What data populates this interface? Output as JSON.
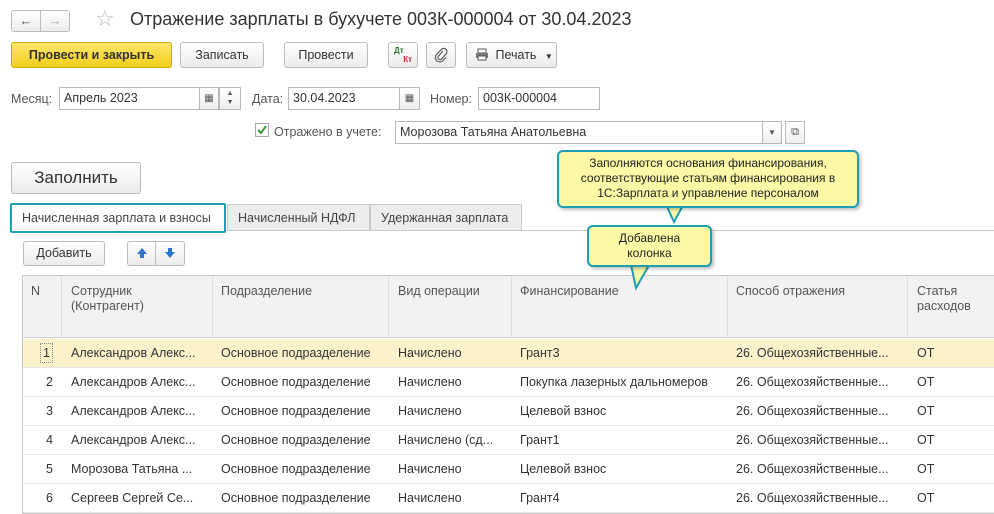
{
  "window": {
    "title": "Отражение зарплаты в бухучете 003К-000004 от 30.04.2023"
  },
  "toolbar": {
    "post_close": "Провести и закрыть",
    "save": "Записать",
    "post": "Провести",
    "dtkt_top": "Дт",
    "dtkt_bottom": "Кт",
    "print": "Печать"
  },
  "form": {
    "month_label": "Месяц:",
    "month_value": "Апрель 2023",
    "date_label": "Дата:",
    "date_value": "30.04.2023",
    "number_label": "Номер:",
    "number_value": "003К-000004",
    "reflected_label": "Отражено в учете:",
    "reflected_checked": true,
    "responsible_value": "Морозова Татьяна Анатольевна"
  },
  "fill_button": "Заполнить",
  "tabs": [
    {
      "label": "Начисленная зарплата и взносы",
      "active": true
    },
    {
      "label": "Начисленный НДФЛ",
      "active": false
    },
    {
      "label": "Удержанная зарплата",
      "active": false
    }
  ],
  "table_toolbar": {
    "add": "Добавить"
  },
  "table": {
    "columns": [
      "N",
      "Сотрудник (Контрагент)",
      "Подразделение",
      "Вид операции",
      "Финансирование",
      "Способ отражения",
      "Статья расходов"
    ],
    "rows": [
      {
        "n": "1",
        "employee": "Александров Алекс...",
        "dept": "Основное подразделение",
        "op": "Начислено",
        "fin": "Грант3",
        "method": "26. Общехозяйственные...",
        "item": "ОТ",
        "selected": true
      },
      {
        "n": "2",
        "employee": "Александров Алекс...",
        "dept": "Основное подразделение",
        "op": "Начислено",
        "fin": "Покупка лазерных дальномеров",
        "method": "26. Общехозяйственные...",
        "item": "ОТ",
        "selected": false
      },
      {
        "n": "3",
        "employee": "Александров Алекс...",
        "dept": "Основное подразделение",
        "op": "Начислено",
        "fin": "Целевой взнос",
        "method": "26. Общехозяйственные...",
        "item": "ОТ",
        "selected": false
      },
      {
        "n": "4",
        "employee": "Александров Алекс...",
        "dept": "Основное подразделение",
        "op": "Начислено (сд...",
        "fin": "Грант1",
        "method": "26. Общехозяйственные...",
        "item": "ОТ",
        "selected": false
      },
      {
        "n": "5",
        "employee": "Морозова Татьяна ...",
        "dept": "Основное подразделение",
        "op": "Начислено",
        "fin": "Целевой взнос",
        "method": "26. Общехозяйственные...",
        "item": "ОТ",
        "selected": false
      },
      {
        "n": "6",
        "employee": "Сергеев Сергей Се...",
        "dept": "Основное подразделение",
        "op": "Начислено",
        "fin": "Грант4",
        "method": "26. Общехозяйственные...",
        "item": "ОТ",
        "selected": false
      }
    ]
  },
  "callouts": {
    "financing": "Заполняются основания финансирования, соответствующие статьям финансирования в 1С:Зарплата и управление персоналом",
    "column": "Добавлена колонка"
  },
  "colors": {
    "primary_button": "#f1cf1a",
    "highlight_border": "#1c9fb3",
    "callout_bg": "#fbf9a6",
    "selected_row": "#fbf2cc"
  }
}
